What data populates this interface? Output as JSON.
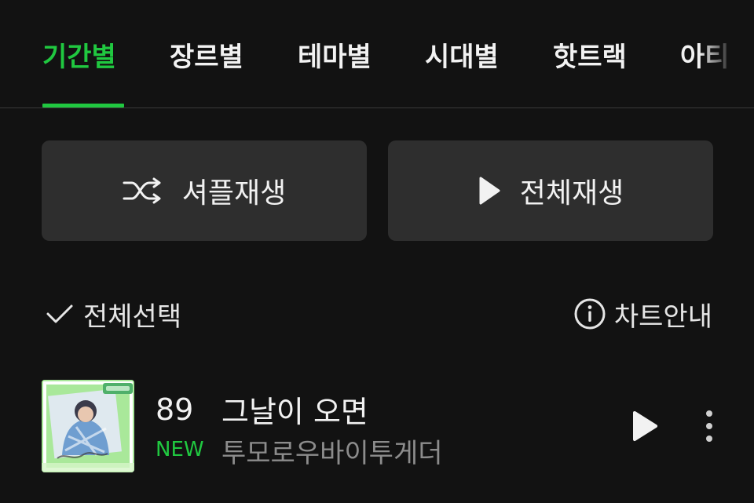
{
  "tabs": [
    {
      "label": "기간별",
      "active": true
    },
    {
      "label": "장르별",
      "active": false
    },
    {
      "label": "테마별",
      "active": false
    },
    {
      "label": "시대별",
      "active": false
    },
    {
      "label": "핫트랙",
      "active": false
    },
    {
      "label": "아티",
      "active": false
    }
  ],
  "actions": {
    "shuffle_label": "셔플재생",
    "shuffle_icon": "shuffle-icon",
    "play_all_label": "전체재생",
    "play_all_icon": "play-icon"
  },
  "toolbar": {
    "select_all_label": "전체선택",
    "select_all_icon": "check-icon",
    "chart_info_label": "차트안내",
    "chart_info_icon": "info-icon"
  },
  "tracks": [
    {
      "rank": "89",
      "badge": "NEW",
      "title": "그날이 오면",
      "artist": "투모로우바이투게더",
      "play_icon": "play-icon",
      "more_icon": "more-vertical-icon"
    }
  ],
  "colors": {
    "background": "#121212",
    "accent": "#20c840",
    "button_bg": "#2e2e2e",
    "text_primary": "#f2f2f2",
    "text_secondary": "#8c8c8c"
  }
}
